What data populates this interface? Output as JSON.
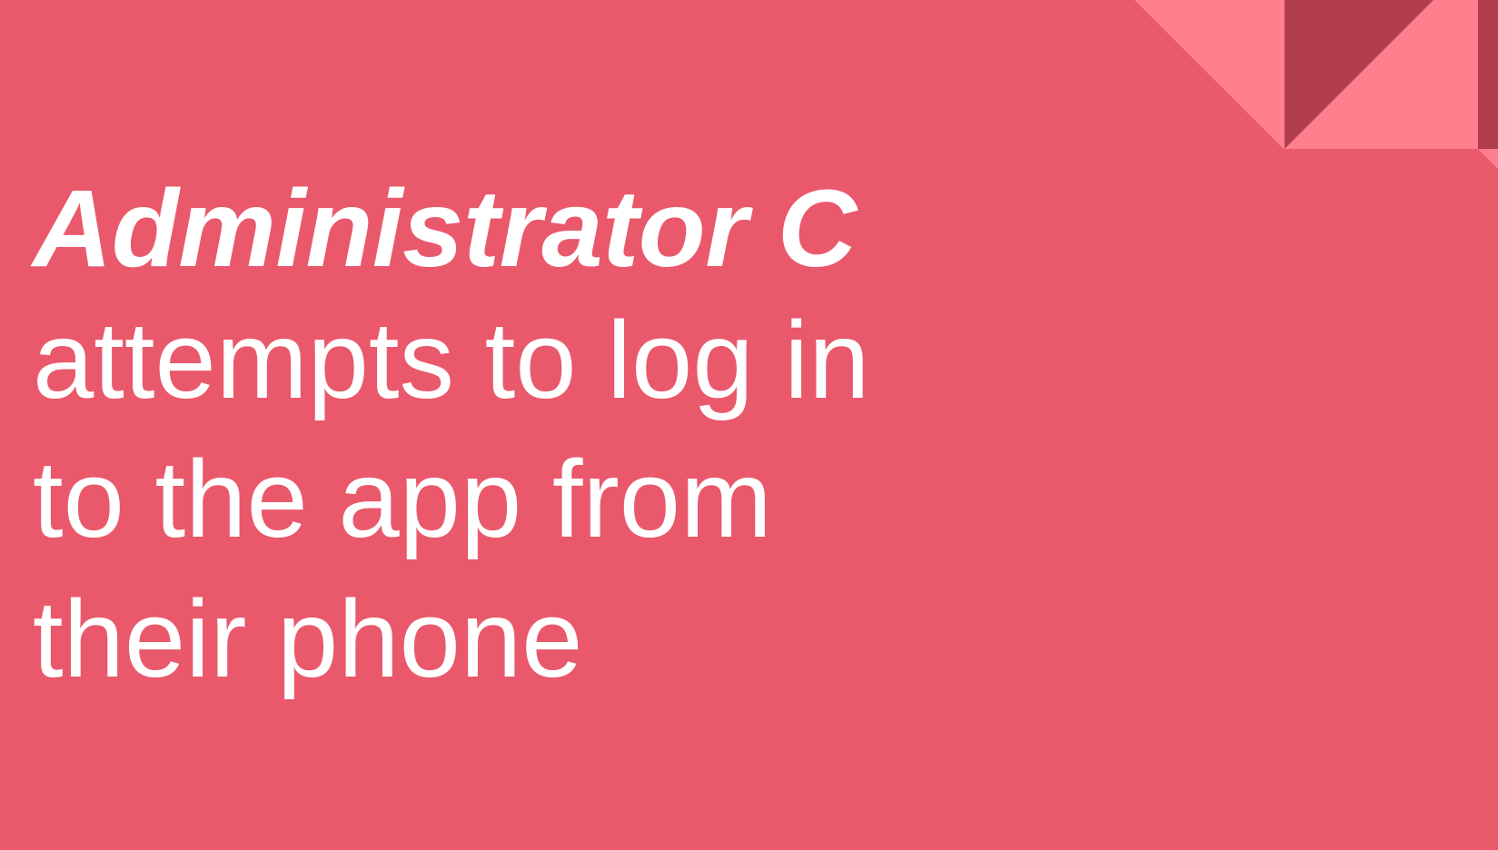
{
  "slide": {
    "title": "Administrator C",
    "body_lines": [
      "attempts to log in",
      "to the app from",
      "their phone"
    ]
  },
  "colors": {
    "background": "#e9596b",
    "light_triangle": "#ff7f8e",
    "dark_triangle": "#b23e4d",
    "text": "#ffffff"
  },
  "decoration": {
    "shape": "corner-triangles"
  }
}
